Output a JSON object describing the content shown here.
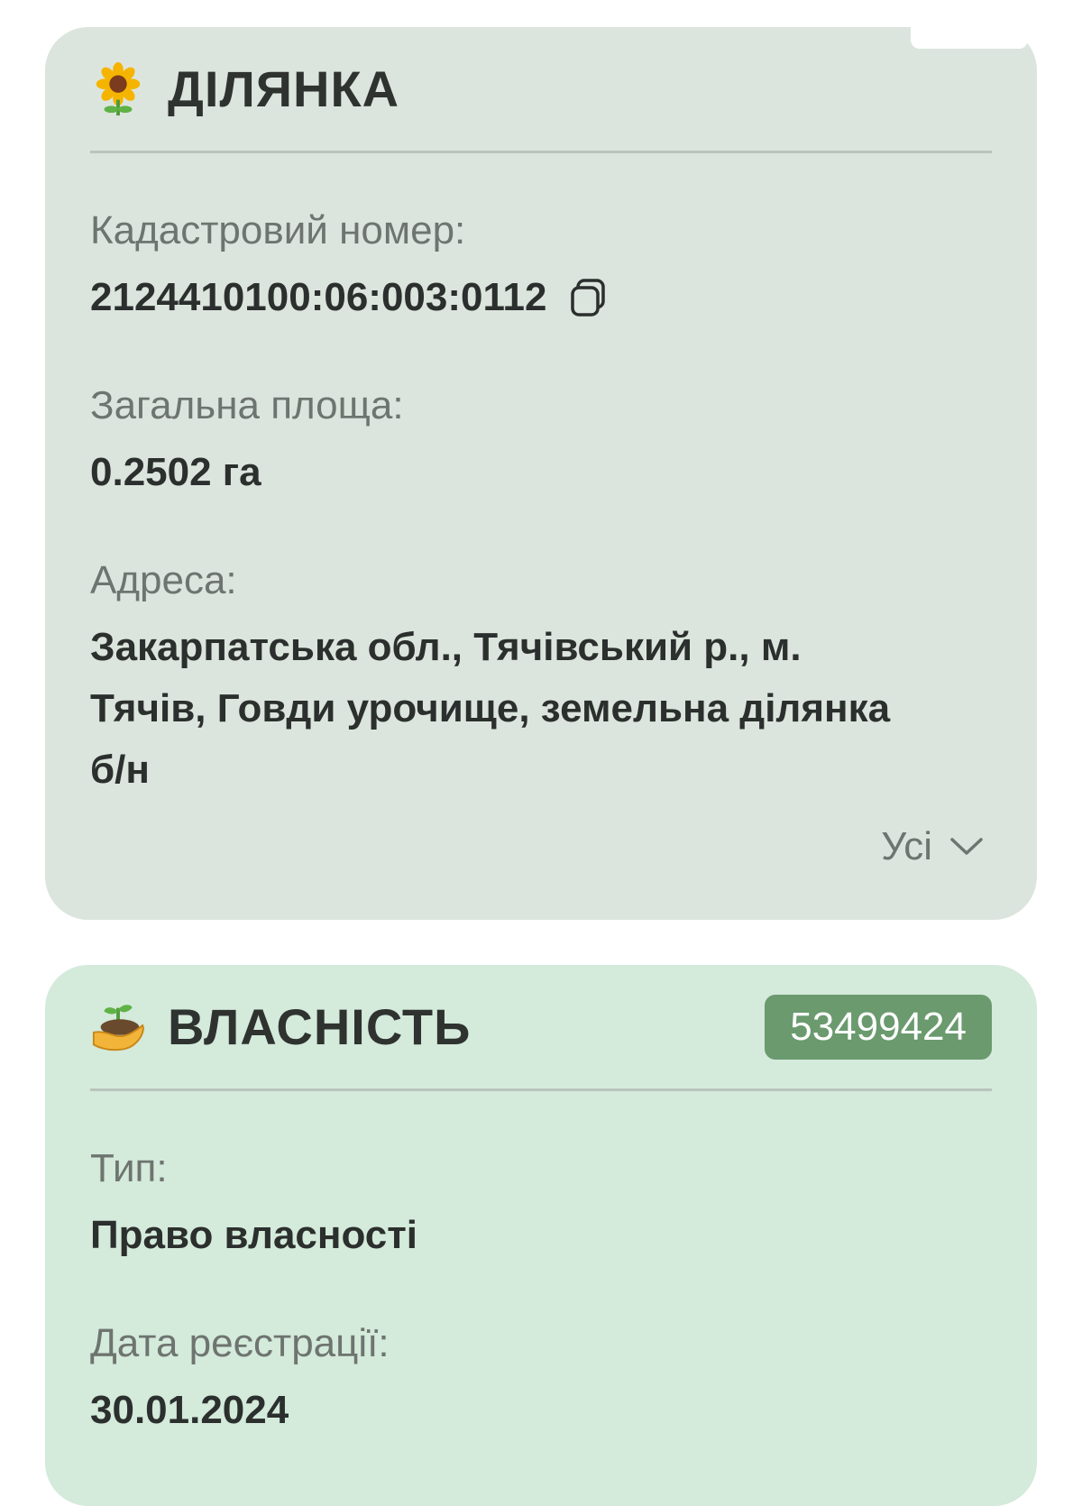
{
  "colors": {
    "plot_card_bg": "#dce5dd",
    "ownership_card_bg": "#d4eadb",
    "badge_bg": "#6a9a6e"
  },
  "plot_card": {
    "icon": "sunflower-icon",
    "title": "ДІЛЯНКА",
    "cadastral_label": "Кадастровий номер:",
    "cadastral_value": "2124410100:06:003:0112",
    "area_label": "Загальна площа:",
    "area_value": "0.2502 га",
    "address_label": "Адреса:",
    "address_value": "Закарпатська обл., Тячівський р., м. Тячів, Говди урочище, земельна ділянка б/н",
    "expand_label": "Усі"
  },
  "ownership_card": {
    "icon": "seedling-hand-icon",
    "title": "ВЛАСНІСТЬ",
    "badge": "53499424",
    "type_label": "Тип:",
    "type_value": "Право власності",
    "reg_date_label": "Дата реєстрації:",
    "reg_date_value": "30.01.2024"
  }
}
